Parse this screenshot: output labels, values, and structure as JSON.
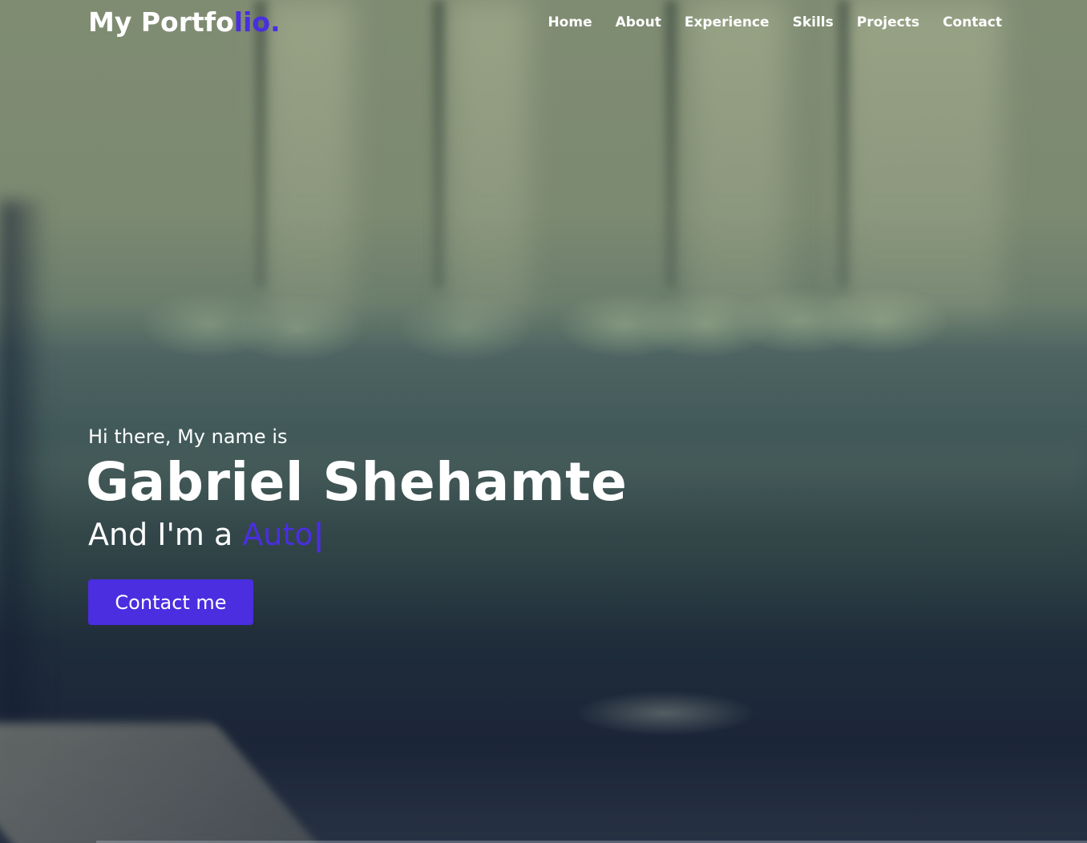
{
  "colors": {
    "accent": "#4a2ee0",
    "text": "#ffffff"
  },
  "navbar": {
    "logo_main": "My Portfo",
    "logo_accent": "lio.",
    "items": [
      {
        "label": "Home"
      },
      {
        "label": "About"
      },
      {
        "label": "Experience"
      },
      {
        "label": "Skills"
      },
      {
        "label": "Projects"
      },
      {
        "label": "Contact"
      }
    ]
  },
  "hero": {
    "greeting": "Hi there, My name is",
    "name": "Gabriel Shehamte",
    "role_prefix": "And I'm a ",
    "role_typed": "Auto",
    "cursor": "|",
    "cta_label": "Contact me"
  }
}
